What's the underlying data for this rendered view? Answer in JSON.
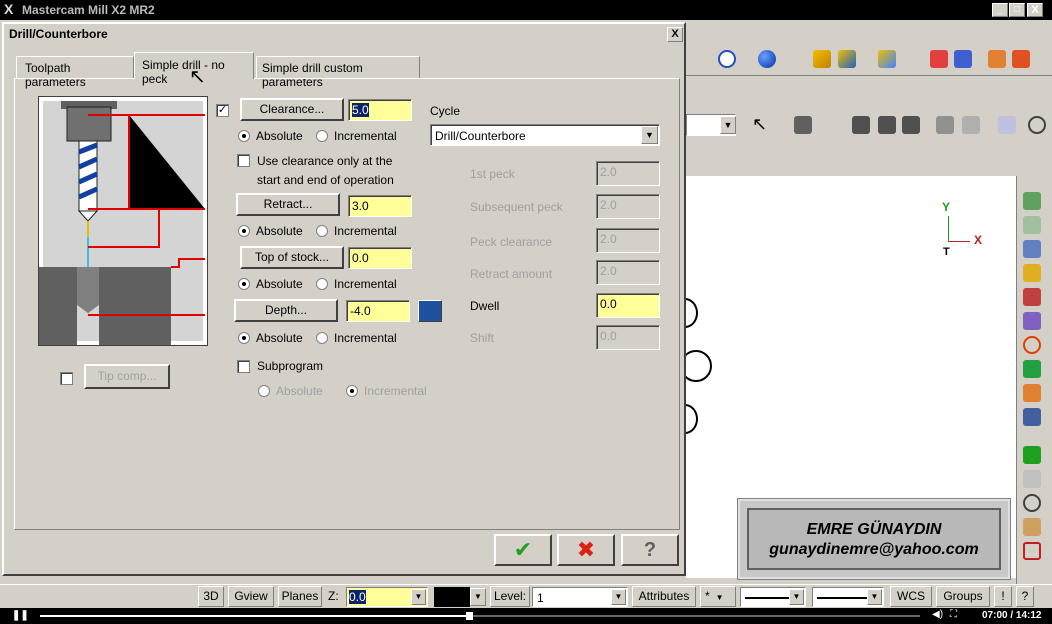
{
  "app": {
    "title": "Mastercam Mill X2 MR2"
  },
  "window_buttons": [
    "_",
    "□",
    "X"
  ],
  "dialog": {
    "title": "Drill/Counterbore",
    "close": "X",
    "tabs": [
      "Toolpath parameters",
      "Simple drill - no peck",
      "Simple drill custom parameters"
    ],
    "tip_comp": "Tip comp...",
    "clearance": {
      "label": "Clearance...",
      "value": "5.0"
    },
    "retract": {
      "label": "Retract...",
      "value": "3.0"
    },
    "top_of_stock": {
      "label": "Top of stock...",
      "value": "0.0"
    },
    "depth": {
      "label": "Depth...",
      "value": "-4.0"
    },
    "absolute": "Absolute",
    "incremental": "Incremental",
    "use_clearance_line1": "Use clearance only at the",
    "use_clearance_line2": "start and end of operation",
    "subprogram": "Subprogram",
    "cycle_label": "Cycle",
    "cycle_value": "Drill/Counterbore",
    "params": [
      {
        "label": "1st peck",
        "value": "2.0"
      },
      {
        "label": "Subsequent peck",
        "value": "2.0"
      },
      {
        "label": "Peck clearance",
        "value": "2.0"
      },
      {
        "label": "Retract amount",
        "value": "2.0"
      },
      {
        "label": "Dwell",
        "value": "0.0"
      },
      {
        "label": "Shift",
        "value": "0.0"
      }
    ],
    "ok_icon": "✔",
    "cancel_icon": "✖",
    "help_icon": "?"
  },
  "viewport": {
    "axis_y": "Y",
    "axis_x": "X",
    "axis_t": "T"
  },
  "watermark": {
    "name": "EMRE GÜNAYDIN",
    "email": "gunaydinemre@yahoo.com"
  },
  "statusbar": {
    "btn_3d": "3D",
    "gview": "Gview",
    "planes": "Planes",
    "z_label": "Z:",
    "z_value": "0.0",
    "level_label": "Level:",
    "level_value": "1",
    "attributes": "Attributes",
    "wcs": "WCS",
    "groups": "Groups",
    "bang": "!",
    "help": "?"
  },
  "video": {
    "time": "07:00 / 14:12"
  }
}
